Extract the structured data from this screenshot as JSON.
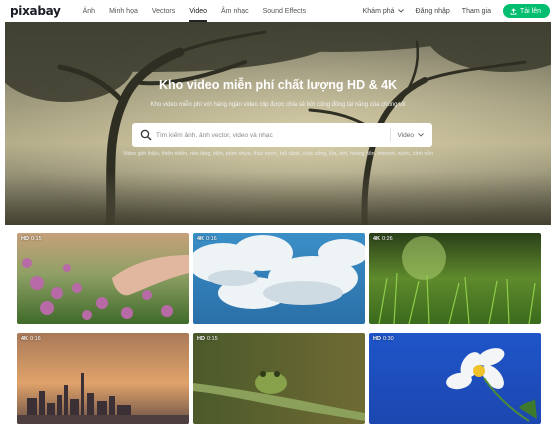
{
  "header": {
    "logo": "pixabay",
    "nav": [
      "Ảnh",
      "Minh họa",
      "Vectors",
      "Video",
      "Âm nhạc",
      "Sound Effects"
    ],
    "active_nav": "Video",
    "explore": "Khám phá",
    "login": "Đăng nhập",
    "join": "Tham gia",
    "upload": "Tải lên"
  },
  "hero": {
    "title": "Kho video miễn phí chất lượng HD & 4K",
    "subtitle": "Kho video miễn phí với hàng ngàn video clip được chia sẻ bởi cộng đồng tài năng của chúng tôi",
    "search_placeholder": "Tìm kiếm ảnh, ảnh vector, video và nhạc",
    "search_type": "Video",
    "tags": "Video giới thiệu, thiên nhiên, nền tảng, biển, phim nhựa, thác nước, bối cảnh, cuộc sống, lửa, trời, hoàng hôn, internet, nước, hình nền"
  },
  "videos": [
    {
      "quality": "HD",
      "duration": "0:15"
    },
    {
      "quality": "4K",
      "duration": "0:16"
    },
    {
      "quality": "4K",
      "duration": "0:26"
    },
    {
      "quality": "4K",
      "duration": "0:16"
    },
    {
      "quality": "HD",
      "duration": "0:15"
    },
    {
      "quality": "HD",
      "duration": "0:30"
    }
  ],
  "colors": {
    "accent": "#02be6e",
    "header_bg": "#ffffff"
  }
}
